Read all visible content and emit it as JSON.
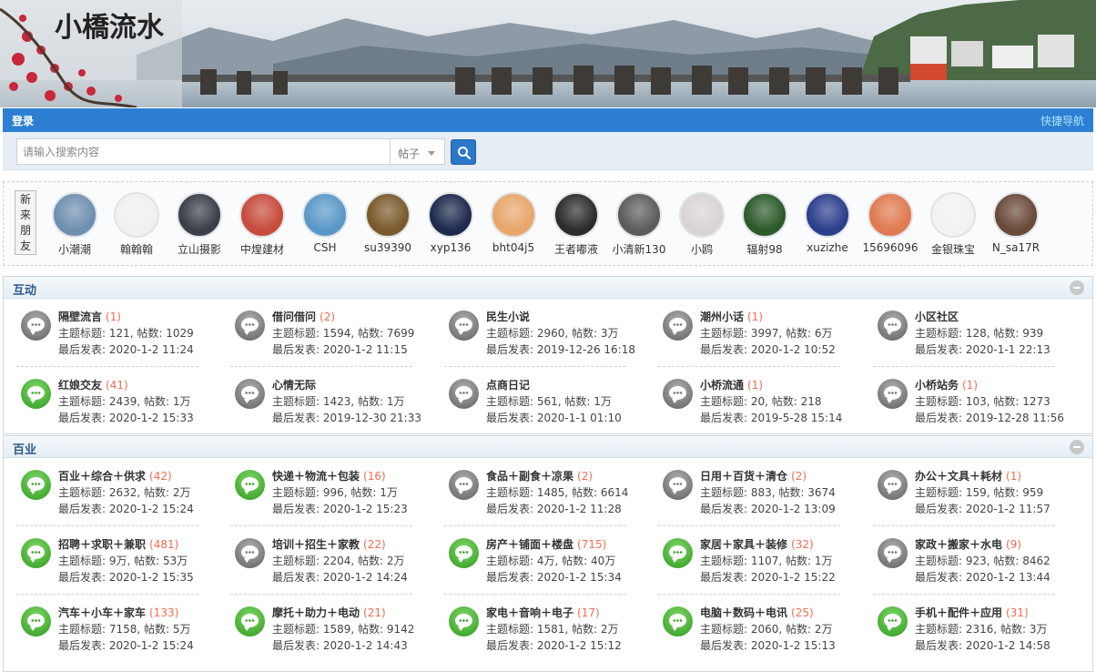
{
  "banner": {
    "logo_text": "小橋流水"
  },
  "navbar": {
    "login": "登录",
    "quick_nav": "快捷导航"
  },
  "search": {
    "placeholder": "请输入搜索内容",
    "type": "帖子"
  },
  "friends": {
    "tag": "新来朋友",
    "tag_chars": [
      "新",
      "来",
      "朋",
      "友"
    ],
    "items": [
      {
        "name": "小潮潮",
        "color": "#6f8fb0"
      },
      {
        "name": "翰翰翰",
        "color": "#f0f0f0"
      },
      {
        "name": "立山摄影",
        "color": "#3a3f48"
      },
      {
        "name": "中煌建材",
        "color": "#c74b3c"
      },
      {
        "name": "CSH",
        "color": "#5a98c9"
      },
      {
        "name": "su39390",
        "color": "#7a5a2c"
      },
      {
        "name": "xyp136",
        "color": "#1e2a4e"
      },
      {
        "name": "bht04j5",
        "color": "#e8a66a"
      },
      {
        "name": "王者嘟液",
        "color": "#2c2c2c"
      },
      {
        "name": "小清新130",
        "color": "#5c5c5c"
      },
      {
        "name": "小鸥",
        "color": "#d9d4d4"
      },
      {
        "name": "辐射98",
        "color": "#2d5a2a"
      },
      {
        "name": "xuzizhe",
        "color": "#2b3f8c"
      },
      {
        "name": "15696096",
        "color": "#e07a50"
      },
      {
        "name": "金银珠宝",
        "color": "#f2f2f2"
      },
      {
        "name": "N_sa17R",
        "color": "#6a4a3a"
      }
    ]
  },
  "sections": [
    {
      "title": "互动",
      "forums": [
        {
          "name": "隔壁流言",
          "count": "(1)",
          "topics": "主题标题: 121, 帖数: 1029",
          "last": "最后发表: 2020-1-2 11:24",
          "icon": "gray"
        },
        {
          "name": "借问借问",
          "count": "(2)",
          "topics": "主题标题: 1594, 帖数: 7699",
          "last": "最后发表: 2020-1-2 11:15",
          "icon": "gray"
        },
        {
          "name": "民生小说",
          "count": "",
          "topics": "主题标题: 2960, 帖数: 3万",
          "last": "最后发表: 2019-12-26 16:18",
          "icon": "gray"
        },
        {
          "name": "潮州小话",
          "count": "(1)",
          "topics": "主题标题: 3997, 帖数: 6万",
          "last": "最后发表: 2020-1-2 10:52",
          "icon": "gray"
        },
        {
          "name": "小区社区",
          "count": "",
          "topics": "主题标题: 128, 帖数: 939",
          "last": "最后发表: 2020-1-1 22:13",
          "icon": "gray"
        },
        {
          "name": "红娘交友",
          "count": "(41)",
          "topics": "主题标题: 2439, 帖数: 1万",
          "last": "最后发表: 2020-1-2 15:33",
          "icon": "green"
        },
        {
          "name": "心情无际",
          "count": "",
          "topics": "主题标题: 1423, 帖数: 1万",
          "last": "最后发表: 2019-12-30 21:33",
          "icon": "gray"
        },
        {
          "name": "点商日记",
          "count": "",
          "topics": "主题标题: 561, 帖数: 1万",
          "last": "最后发表: 2020-1-1 01:10",
          "icon": "gray"
        },
        {
          "name": "小桥流通",
          "count": "(1)",
          "topics": "主题标题: 20, 帖数: 218",
          "last": "最后发表: 2019-5-28 15:14",
          "icon": "gray"
        },
        {
          "name": "小桥站务",
          "count": "(1)",
          "topics": "主题标题: 103, 帖数: 1273",
          "last": "最后发表: 2019-12-28 11:56",
          "icon": "gray"
        }
      ]
    },
    {
      "title": "百业",
      "forums": [
        {
          "name": "百业＋综合＋供求",
          "count": "(42)",
          "topics": "主题标题: 2632, 帖数: 2万",
          "last": "最后发表: 2020-1-2 15:24",
          "icon": "green"
        },
        {
          "name": "快递＋物流＋包装",
          "count": "(16)",
          "topics": "主题标题: 996, 帖数: 1万",
          "last": "最后发表: 2020-1-2 15:23",
          "icon": "green"
        },
        {
          "name": "食品＋副食＋凉果",
          "count": "(2)",
          "topics": "主题标题: 1485, 帖数: 6614",
          "last": "最后发表: 2020-1-2 11:28",
          "icon": "gray"
        },
        {
          "name": "日用＋百货＋清仓",
          "count": "(2)",
          "topics": "主题标题: 883, 帖数: 3674",
          "last": "最后发表: 2020-1-2 13:09",
          "icon": "gray"
        },
        {
          "name": "办公＋文具＋耗材",
          "count": "(1)",
          "topics": "主题标题: 159, 帖数: 959",
          "last": "最后发表: 2020-1-2 11:57",
          "icon": "gray"
        },
        {
          "name": "招聘＋求职＋兼职",
          "count": "(481)",
          "topics": "主题标题: 9万, 帖数: 53万",
          "last": "最后发表: 2020-1-2 15:35",
          "icon": "green"
        },
        {
          "name": "培训＋招生＋家教",
          "count": "(22)",
          "topics": "主题标题: 2204, 帖数: 2万",
          "last": "最后发表: 2020-1-2 14:24",
          "icon": "gray"
        },
        {
          "name": "房产＋铺面＋楼盘",
          "count": "(715)",
          "topics": "主题标题: 4万, 帖数: 40万",
          "last": "最后发表: 2020-1-2 15:34",
          "icon": "green"
        },
        {
          "name": "家居＋家具＋装修",
          "count": "(32)",
          "topics": "主题标题: 1107, 帖数: 1万",
          "last": "最后发表: 2020-1-2 15:22",
          "icon": "green"
        },
        {
          "name": "家政＋搬家＋水电",
          "count": "(9)",
          "topics": "主题标题: 923, 帖数: 8462",
          "last": "最后发表: 2020-1-2 13:44",
          "icon": "gray"
        },
        {
          "name": "汽车＋小车＋家车",
          "count": "(133)",
          "topics": "主题标题: 7158, 帖数: 5万",
          "last": "最后发表: 2020-1-2 15:24",
          "icon": "green"
        },
        {
          "name": "摩托＋助力＋电动",
          "count": "(21)",
          "topics": "主题标题: 1589, 帖数: 9142",
          "last": "最后发表: 2020-1-2 14:43",
          "icon": "green"
        },
        {
          "name": "家电＋音响＋电子",
          "count": "(17)",
          "topics": "主题标题: 1581, 帖数: 2万",
          "last": "最后发表: 2020-1-2 15:12",
          "icon": "green"
        },
        {
          "name": "电脑＋数码＋电讯",
          "count": "(25)",
          "topics": "主题标题: 2060, 帖数: 2万",
          "last": "最后发表: 2020-1-2 15:13",
          "icon": "green"
        },
        {
          "name": "手机＋配件＋应用",
          "count": "(31)",
          "topics": "主题标题: 2316, 帖数: 3万",
          "last": "最后发表: 2020-1-2 14:58",
          "icon": "green"
        }
      ]
    }
  ]
}
